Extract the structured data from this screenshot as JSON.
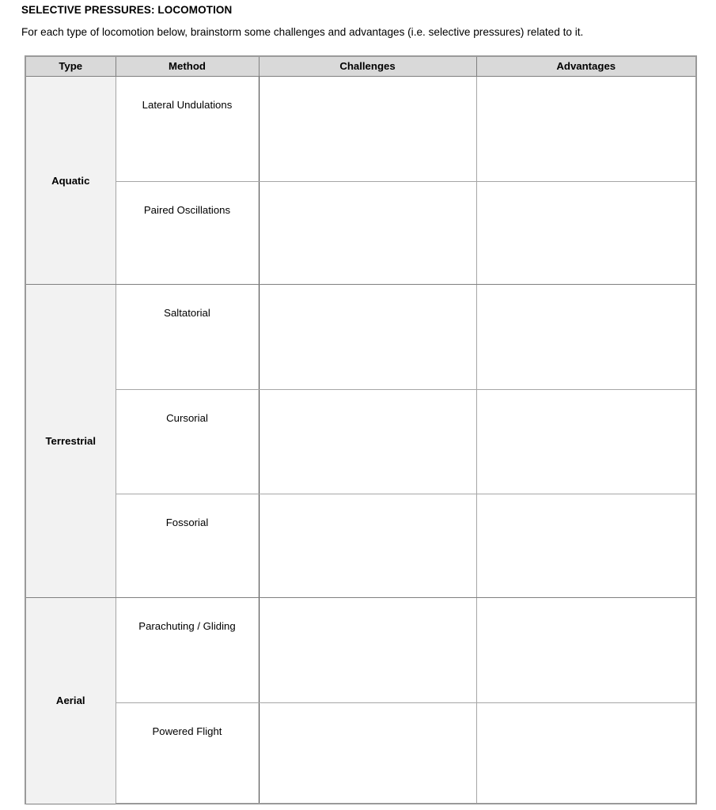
{
  "document": {
    "title": "SELECTIVE PRESSURES: LOCOMOTION",
    "intro": "For each type of locomotion below, brainstorm some challenges and advantages (i.e. selective pressures) related to it."
  },
  "table": {
    "headers": {
      "type": "Type",
      "method": "Method",
      "challenges": "Challenges",
      "advantages": "Advantages"
    },
    "colors": {
      "header_fill": "#d9d9d9",
      "type_column_fill": "#f2f2f2",
      "cell_fill": "#ffffff",
      "border": "#a6a6a6",
      "border_strong": "#404040",
      "text": "#000000"
    },
    "groups": [
      {
        "type": "Aquatic",
        "rows": [
          {
            "method": "Lateral Undulations",
            "challenges": "",
            "advantages": ""
          },
          {
            "method": "Paired Oscillations",
            "challenges": "",
            "advantages": ""
          }
        ]
      },
      {
        "type": "Terrestrial",
        "rows": [
          {
            "method": "Saltatorial",
            "challenges": "",
            "advantages": ""
          },
          {
            "method": "Cursorial",
            "challenges": "",
            "advantages": ""
          },
          {
            "method": "Fossorial",
            "challenges": "",
            "advantages": ""
          }
        ]
      },
      {
        "type": "Aerial",
        "rows": [
          {
            "method": "Parachuting / Gliding",
            "challenges": "",
            "advantages": ""
          },
          {
            "method": "Powered Flight",
            "challenges": "",
            "advantages": ""
          }
        ]
      }
    ]
  }
}
